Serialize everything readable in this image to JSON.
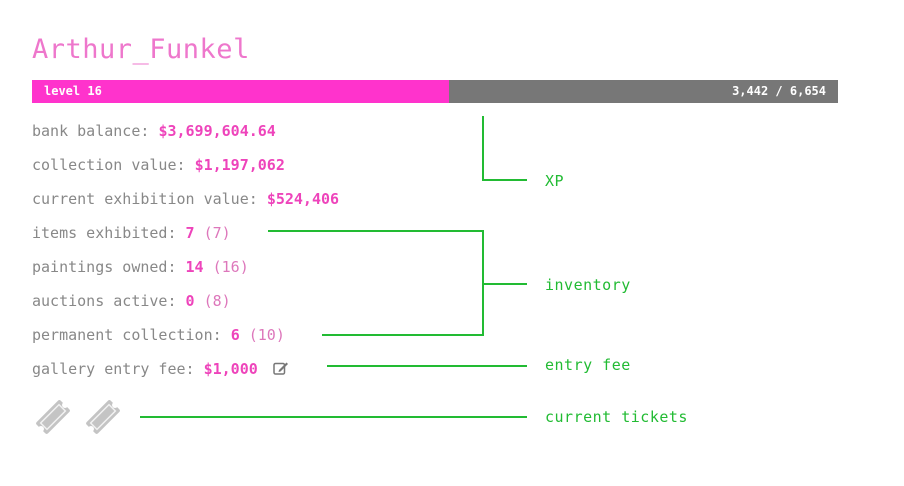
{
  "player": {
    "username": "Arthur_Funkel"
  },
  "xp": {
    "level_label": "level 16",
    "current": 3442,
    "max": 6654,
    "display": "3,442 / 6,654",
    "fill_color": "#ff33cc",
    "track_color": "#777777"
  },
  "stats": {
    "bank_balance": {
      "label": "bank balance:",
      "value": "$3,699,604.64"
    },
    "collection_value": {
      "label": "collection value:",
      "value": "$1,197,062"
    },
    "exhibition_value": {
      "label": "current exhibition value:",
      "value": "$524,406"
    },
    "items_exhibited": {
      "label": "items exhibited:",
      "value": "7",
      "paren": "(7)"
    },
    "paintings_owned": {
      "label": "paintings owned:",
      "value": "14",
      "paren": "(16)"
    },
    "auctions_active": {
      "label": "auctions active:",
      "value": "0",
      "paren": "(8)"
    },
    "permanent_collection": {
      "label": "permanent collection:",
      "value": "6",
      "paren": "(10)"
    },
    "entry_fee": {
      "label": "gallery entry fee:",
      "value": "$1,000",
      "icon": "edit-icon"
    }
  },
  "tickets": {
    "count": 2,
    "icon": "ticket-icon"
  },
  "annotations": {
    "xp": "XP",
    "inventory": "inventory",
    "entry_fee": "entry fee",
    "tickets": "current tickets",
    "color": "#22bb33"
  },
  "colors": {
    "accent": "#ff33cc",
    "value": "#ee44bb",
    "username": "#ee77cc",
    "label": "#888888"
  }
}
